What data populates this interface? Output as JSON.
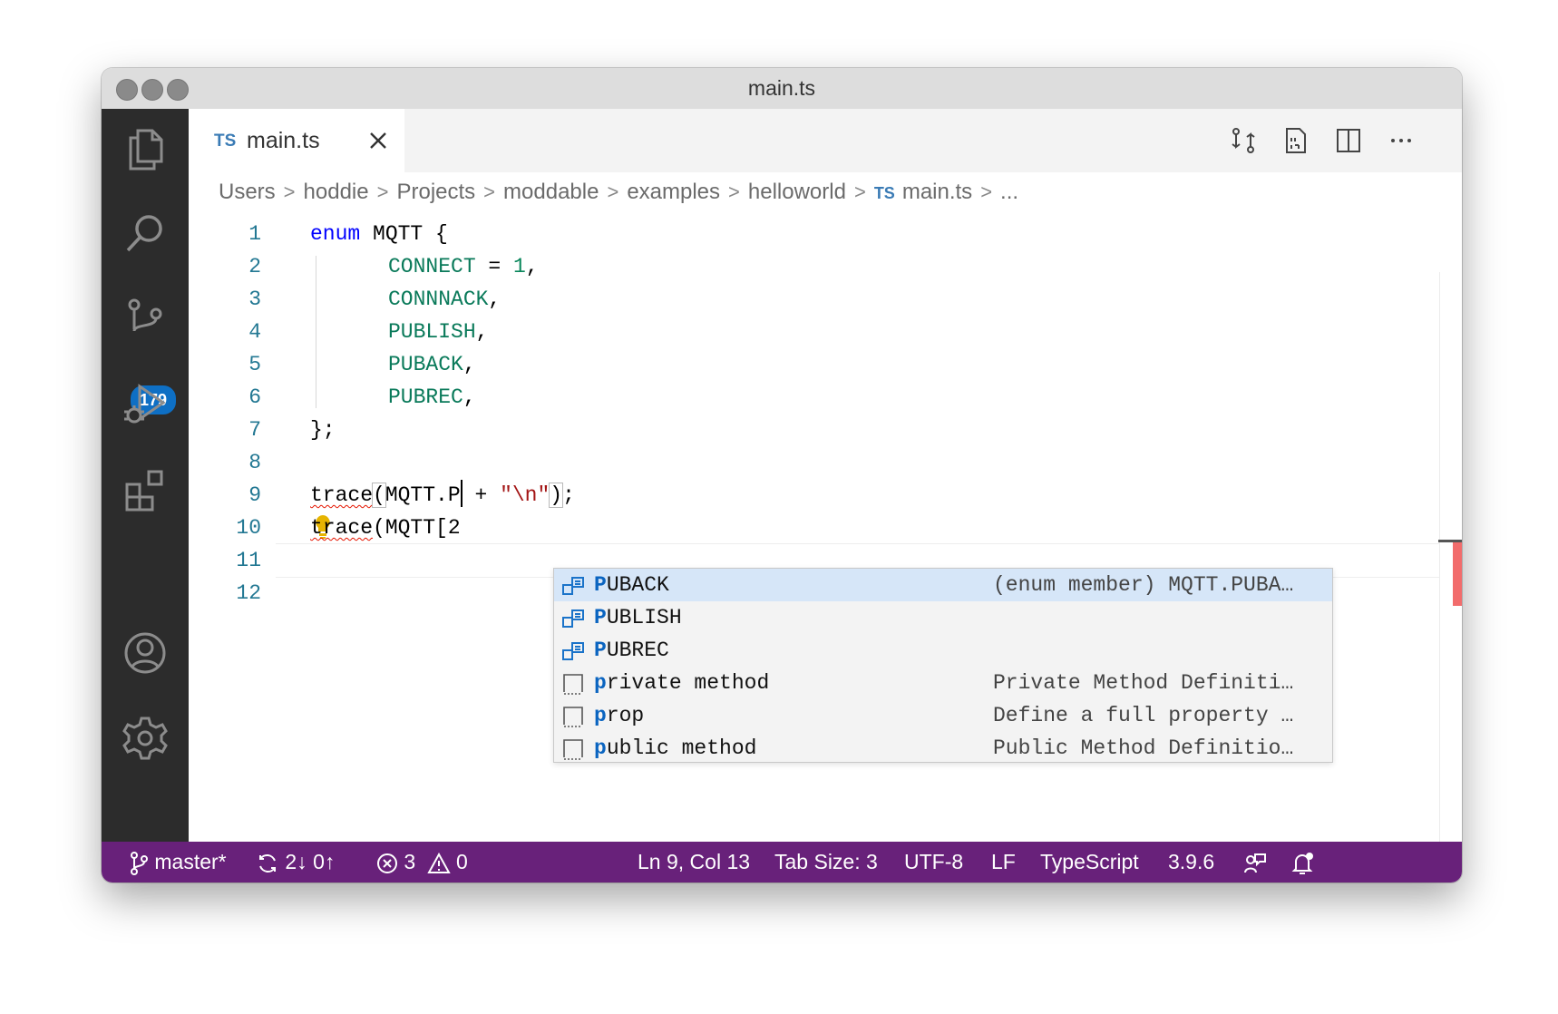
{
  "window": {
    "title": "main.ts"
  },
  "activity_bar": {
    "items": [
      {
        "name": "explorer",
        "icon": "files-icon"
      },
      {
        "name": "search",
        "icon": "search-icon"
      },
      {
        "name": "source-control",
        "icon": "source-control-icon",
        "badge": "179"
      },
      {
        "name": "run-debug",
        "icon": "run-debug-icon"
      },
      {
        "name": "extensions",
        "icon": "extensions-icon"
      }
    ],
    "bottom": [
      {
        "name": "accounts",
        "icon": "account-icon"
      },
      {
        "name": "manage",
        "icon": "gear-icon"
      }
    ],
    "badge": "179"
  },
  "tabs": [
    {
      "lang": "TS",
      "label": "main.ts",
      "active": true
    }
  ],
  "tab_actions": [
    "open-changes-icon",
    "open-preview-icon",
    "split-editor-icon",
    "more-actions-icon"
  ],
  "breadcrumb": {
    "parts": [
      "Users",
      "hoddie",
      "Projects",
      "moddable",
      "examples",
      "helloworld"
    ],
    "file_lang": "TS",
    "file": "main.ts",
    "more": "..."
  },
  "editor": {
    "line_numbers": [
      "1",
      "2",
      "3",
      "4",
      "5",
      "6",
      "7",
      "8",
      "9",
      "10",
      "11",
      "12"
    ],
    "lines": {
      "l1_kw": "enum",
      "l1_rest": " MQTT {",
      "l2_mem": "CONNECT",
      "l2_eq": " = ",
      "l2_num": "1",
      "l2_end": ",",
      "l3_mem": "CONNNACK",
      "l4_mem": "PUBLISH",
      "l5_mem": "PUBACK",
      "l6_mem": "PUBREC",
      "comma": ",",
      "l7": "};",
      "l9_fn": "trace",
      "l9_paren": "(",
      "l9_arg": "MQTT.P",
      "l9_plus": " + ",
      "l9_str": "\"\\n\"",
      "l9_close": ")",
      "l9_end": ";",
      "l10_fn": "trace",
      "l10_rest": "(MQTT[2"
    },
    "cursor": {
      "line": 9,
      "col": 13
    }
  },
  "suggest": {
    "items": [
      {
        "match": "P",
        "rest": "UBACK",
        "detail": "(enum member) MQTT.PUBA…",
        "icon": "enum-member-icon",
        "selected": true
      },
      {
        "match": "P",
        "rest": "UBLISH",
        "detail": "",
        "icon": "enum-member-icon",
        "selected": false
      },
      {
        "match": "P",
        "rest": "UBREC",
        "detail": "",
        "icon": "enum-member-icon",
        "selected": false
      },
      {
        "match": "p",
        "rest": "rivate method",
        "detail": "Private Method Definiti…",
        "icon": "snippet-icon",
        "selected": false
      },
      {
        "match": "p",
        "rest": "rop",
        "detail": "Define a full property …",
        "icon": "snippet-icon",
        "selected": false
      },
      {
        "match": "p",
        "rest": "ublic method",
        "detail": "Public Method Definitio…",
        "icon": "snippet-icon",
        "selected": false
      }
    ]
  },
  "statusbar": {
    "branch": "master*",
    "sync": "2↓ 0↑",
    "errors": "3",
    "warnings": "0",
    "position": "Ln 9, Col 13",
    "tab_size": "Tab Size: 3",
    "encoding": "UTF-8",
    "eol": "LF",
    "language": "TypeScript",
    "version": "3.9.6",
    "color": "#68217a"
  }
}
